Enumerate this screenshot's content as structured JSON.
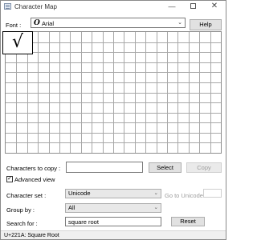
{
  "window": {
    "title": "Character Map",
    "minimize_glyph": "—",
    "close_glyph": "✕"
  },
  "font_row": {
    "label": "Font :",
    "selected": "Arial",
    "type_glyph": "O",
    "help_label": "Help"
  },
  "grid": {
    "columns": 20,
    "rows": 12,
    "selected_char": "√"
  },
  "copy_row": {
    "label": "Characters to copy :",
    "value": "",
    "select_label": "Select",
    "copy_label": "Copy"
  },
  "advanced": {
    "checked": true,
    "check_glyph": "✓",
    "label": "Advanced view"
  },
  "character_set": {
    "label": "Character set :",
    "selected": "Unicode",
    "goto_label": "Go to Unicode :",
    "goto_value": ""
  },
  "group_by": {
    "label": "Group by :",
    "selected": "All"
  },
  "search": {
    "label": "Search for :",
    "value": "square root",
    "reset_label": "Reset"
  },
  "status": {
    "text": "U+221A: Square Root"
  },
  "colors": {
    "grid_line": "#a8a8a8",
    "disabled_text": "#9d9d9d"
  }
}
